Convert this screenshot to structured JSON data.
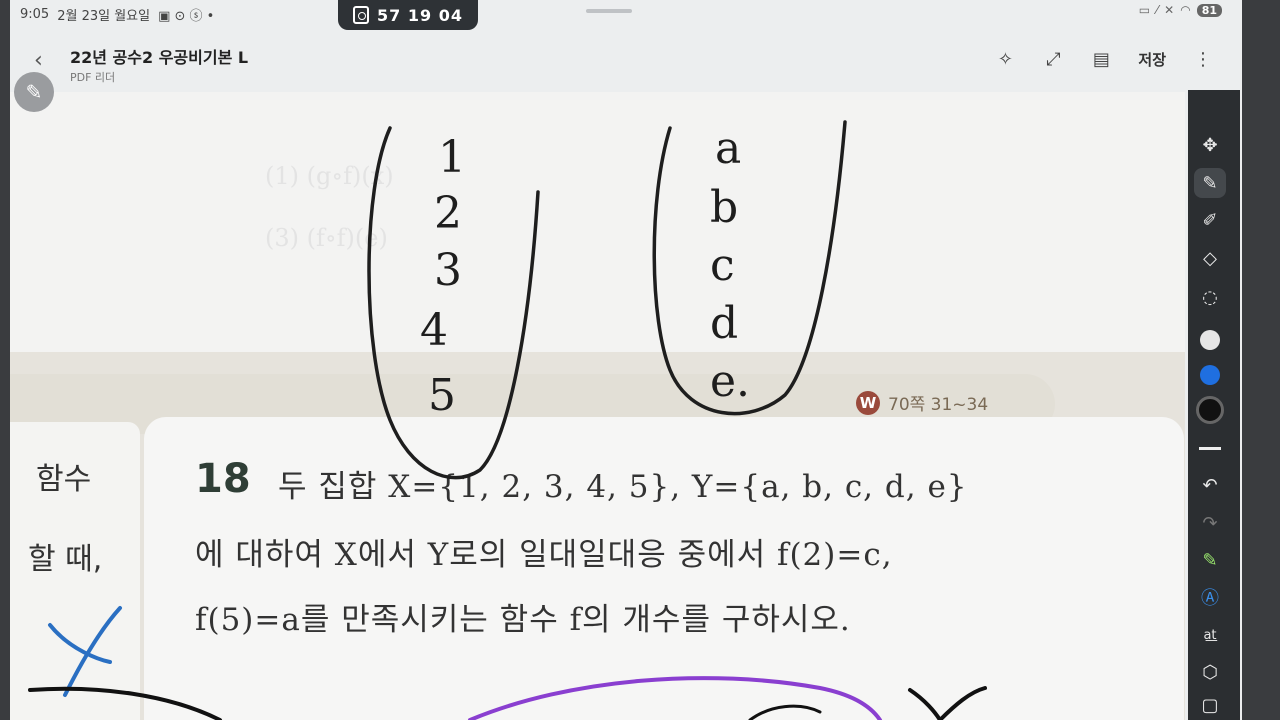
{
  "status_bar": {
    "time": "9:05",
    "date": "2월 23일 월요일",
    "battery": "81"
  },
  "timer": {
    "value": "57 19 04"
  },
  "app_bar": {
    "title": "22년 공수2 우공비기본 L",
    "subtitle": "PDF 리더",
    "save_label": "저장"
  },
  "page": {
    "reference": {
      "badge": "W",
      "text": "70쪽 31~34"
    },
    "prev_problem_fragments": [
      "함수",
      "할 때,"
    ],
    "problem": {
      "number": "18",
      "line1": "두 집합 X={1, 2, 3, 4, 5}, Y={a, b, c, d, e}",
      "line2": "에 대하여 X에서 Y로의 일대일대응 중에서 f(2)=c,",
      "line3": "f(5)=a를 만족시키는 함수 f의 개수를 구하시오."
    },
    "faint_math": [
      "(1) (g∘f)(x)",
      "(3) (f∘f)(e)"
    ]
  },
  "handwriting": {
    "set_x": [
      "1",
      "2",
      "3",
      "4",
      "5"
    ],
    "set_y": [
      "a",
      "b",
      "c",
      "d",
      "e."
    ],
    "colors": {
      "ink": "#1e1e1e",
      "blue": "#2a6fc2",
      "purple": "#8a3fd0"
    }
  },
  "pen_toolbar": {
    "tools": [
      "move-icon",
      "pen-icon",
      "highlighter-icon",
      "eraser-icon",
      "lasso-icon",
      "color-white",
      "color-blue",
      "color-black",
      "stroke-width",
      "undo-icon",
      "redo-icon",
      "shape-pen-icon",
      "text-recognize-icon",
      "text-format-icon",
      "shape-icon",
      "more-icon"
    ],
    "colors": {
      "white": "#e6e6e6",
      "blue": "#1f6fe0",
      "black": "#111111"
    }
  }
}
